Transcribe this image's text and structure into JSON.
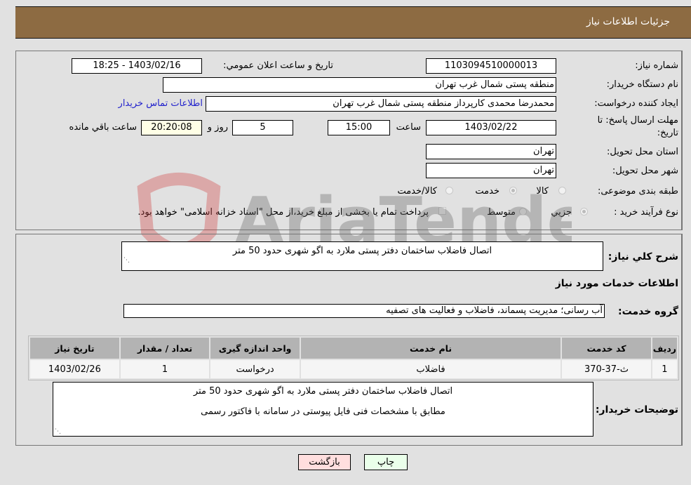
{
  "header": {
    "title": "جزئیات اطلاعات نیاز"
  },
  "form": {
    "need_number": {
      "label": "شماره نیاز:",
      "value": "1103094510000013"
    },
    "announce_datetime": {
      "label": "تاریخ و ساعت اعلان عمومي:",
      "value": "1403/02/16 - 18:25"
    },
    "buyer_org": {
      "label": "نام دستگاه خريدار:",
      "value": "منطقه پستی شمال غرب تهران"
    },
    "creator": {
      "label": "ايجاد کننده درخواست:",
      "value": "محمدرضا  محمدی کارپرداز منطقه پستی شمال غرب تهران",
      "contact_link": "اطلاعات تماس خريدار"
    },
    "deadline": {
      "label_line1": "مهلت ارسال پاسخ: تا",
      "label_line2": "تاریخ:",
      "date": "1403/02/22",
      "time_label": "ساعت",
      "time": "15:00",
      "days": "5",
      "days_label": "روز و",
      "remaining": "20:20:08",
      "remaining_label": "ساعت باقي مانده"
    },
    "province": {
      "label": "استان محل تحويل:",
      "value": "تهران"
    },
    "city": {
      "label": "شهر محل تحويل:",
      "value": "تهران"
    },
    "category": {
      "label": "طبقه بندی موضوعی:",
      "options": [
        "کالا",
        "خدمت",
        "کالا/خدمت"
      ],
      "selected": "خدمت"
    },
    "purchase_type": {
      "label": "نوع فرآيند خريد :",
      "options": [
        "جزيي",
        "متوسط"
      ],
      "selected": "جزيي",
      "treasury_note": "پرداخت تمام يا بخشی از مبلغ خريد،از محل \"اسناد خزانه اسلامی\" خواهد بود."
    }
  },
  "details": {
    "summary_label": "شرح کلي نياز:",
    "summary": "اتصال فاضلاب ساختمان دفتر پستی ملارد به اگو شهری حدود 50 متر",
    "services_heading": "اطلاعات خدمات مورد نياز",
    "service_group_label": "گروه خدمت:",
    "service_group": "آب رسانی؛ مديريت پسماند، فاضلاب و فعاليت های تصفيه",
    "table": {
      "headers": [
        "رديف",
        "کد خدمت",
        "نام خدمت",
        "واحد اندازه گيری",
        "تعداد / مقدار",
        "تاريخ نياز"
      ],
      "rows": [
        [
          "1",
          "ث-37-370",
          "فاضلاب",
          "درخواست",
          "1",
          "1403/02/26"
        ]
      ]
    },
    "buyer_notes_label": "توضيحات خريدار:",
    "buyer_notes_line1": "اتصال فاضلاب ساختمان دفتر پستی ملارد به اگو شهری حدود 50 متر",
    "buyer_notes_line2": "مطابق با مشخصات فنی فایل پیوستی در سامانه  با فاکتور رسمی"
  },
  "buttons": {
    "print": "چاپ",
    "back": "بازگشت"
  },
  "watermark": {
    "text": "AriaTender.neT"
  }
}
